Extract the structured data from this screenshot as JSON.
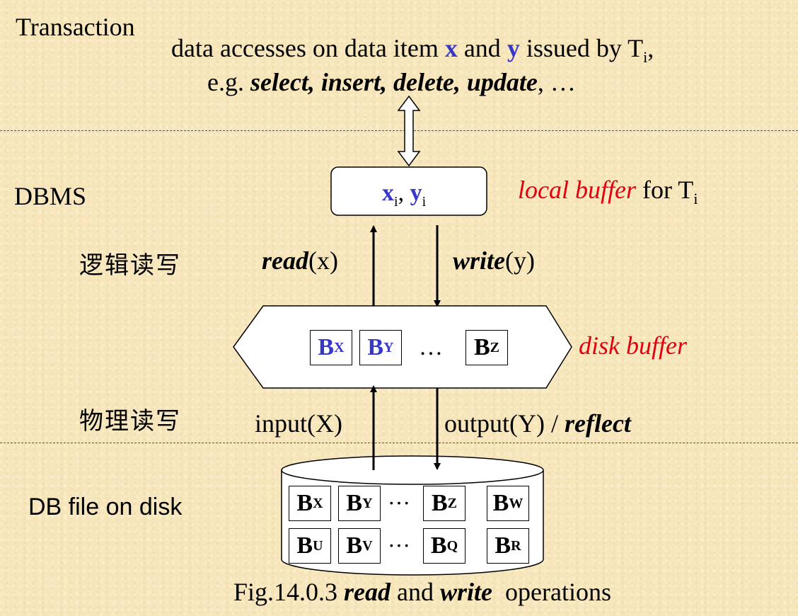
{
  "levels": {
    "transaction": "Transaction",
    "dbms": "DBMS",
    "disk": "DB file on disk"
  },
  "header": {
    "line1_a": "data accesses on data item ",
    "x": "x",
    "line1_b": " and ",
    "y": "y",
    "line1_c": " issued by T",
    "line1_sub": "i",
    "line1_end": ",",
    "line2_a": "e.g. ",
    "line2_ops": "select, insert, delete, update",
    "line2_end": ", …"
  },
  "local_buffer": {
    "x": "x",
    "x_sub": "i",
    "sep": ", ",
    "y": "y",
    "y_sub": "i",
    "label_a": "local buffer",
    "label_b": " for T",
    "label_sub": "i"
  },
  "logical": {
    "label": "逻辑读写",
    "read_fn": "read",
    "read_arg": "(x)",
    "write_fn": "write",
    "write_arg": "(y)"
  },
  "disk_buffer": {
    "label": "disk buffer",
    "ellipsis": "…",
    "blocks": [
      {
        "letter": "B",
        "sub": "X"
      },
      {
        "letter": "B",
        "sub": "Y"
      },
      {
        "letter": "B",
        "sub": "Z"
      }
    ]
  },
  "physical": {
    "label": "物理读写",
    "input": "input(X)",
    "output_a": "output(Y) / ",
    "output_b": "reflect"
  },
  "disk_file": {
    "ellipsis": "···",
    "row1": [
      {
        "letter": "B",
        "sub": "X"
      },
      {
        "letter": "B",
        "sub": "Y"
      },
      {
        "letter": "B",
        "sub": "Z"
      },
      {
        "letter": "B",
        "sub": "W"
      }
    ],
    "row2": [
      {
        "letter": "B",
        "sub": "U"
      },
      {
        "letter": "B",
        "sub": "V"
      },
      {
        "letter": "B",
        "sub": "Q"
      },
      {
        "letter": "B",
        "sub": "R"
      }
    ]
  },
  "caption": {
    "a": "Fig.14.0.3 ",
    "b": "read",
    "c": " and ",
    "d": "write",
    "e": "  operations"
  },
  "colors": {
    "accent_blue": "#3838c8",
    "label_red": "#e3000f",
    "background": "#f7e6bc"
  }
}
